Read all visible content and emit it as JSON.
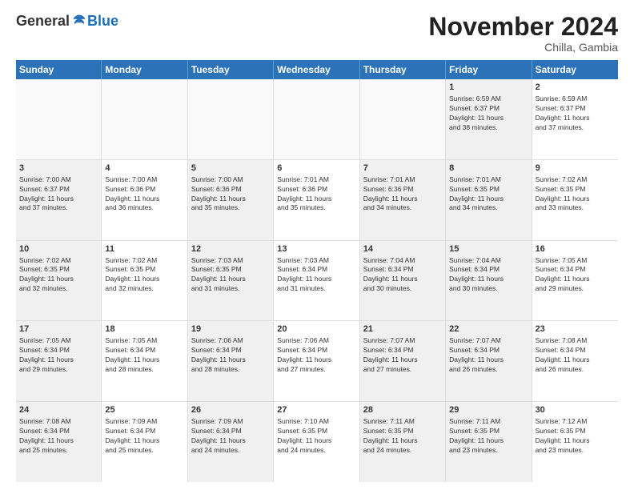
{
  "logo": {
    "general": "General",
    "blue": "Blue"
  },
  "title": "November 2024",
  "location": "Chilla, Gambia",
  "days": [
    "Sunday",
    "Monday",
    "Tuesday",
    "Wednesday",
    "Thursday",
    "Friday",
    "Saturday"
  ],
  "rows": [
    [
      {
        "day": "",
        "empty": true
      },
      {
        "day": "",
        "empty": true
      },
      {
        "day": "",
        "empty": true
      },
      {
        "day": "",
        "empty": true
      },
      {
        "day": "",
        "empty": true
      },
      {
        "day": "1",
        "lines": [
          "Sunrise: 6:59 AM",
          "Sunset: 6:37 PM",
          "Daylight: 11 hours",
          "and 38 minutes."
        ],
        "shaded": true
      },
      {
        "day": "2",
        "lines": [
          "Sunrise: 6:59 AM",
          "Sunset: 6:37 PM",
          "Daylight: 11 hours",
          "and 37 minutes."
        ],
        "shaded": false
      }
    ],
    [
      {
        "day": "3",
        "lines": [
          "Sunrise: 7:00 AM",
          "Sunset: 6:37 PM",
          "Daylight: 11 hours",
          "and 37 minutes."
        ],
        "shaded": true
      },
      {
        "day": "4",
        "lines": [
          "Sunrise: 7:00 AM",
          "Sunset: 6:36 PM",
          "Daylight: 11 hours",
          "and 36 minutes."
        ],
        "shaded": false
      },
      {
        "day": "5",
        "lines": [
          "Sunrise: 7:00 AM",
          "Sunset: 6:36 PM",
          "Daylight: 11 hours",
          "and 35 minutes."
        ],
        "shaded": true
      },
      {
        "day": "6",
        "lines": [
          "Sunrise: 7:01 AM",
          "Sunset: 6:36 PM",
          "Daylight: 11 hours",
          "and 35 minutes."
        ],
        "shaded": false
      },
      {
        "day": "7",
        "lines": [
          "Sunrise: 7:01 AM",
          "Sunset: 6:36 PM",
          "Daylight: 11 hours",
          "and 34 minutes."
        ],
        "shaded": true
      },
      {
        "day": "8",
        "lines": [
          "Sunrise: 7:01 AM",
          "Sunset: 6:35 PM",
          "Daylight: 11 hours",
          "and 34 minutes."
        ],
        "shaded": true
      },
      {
        "day": "9",
        "lines": [
          "Sunrise: 7:02 AM",
          "Sunset: 6:35 PM",
          "Daylight: 11 hours",
          "and 33 minutes."
        ],
        "shaded": false
      }
    ],
    [
      {
        "day": "10",
        "lines": [
          "Sunrise: 7:02 AM",
          "Sunset: 6:35 PM",
          "Daylight: 11 hours",
          "and 32 minutes."
        ],
        "shaded": true
      },
      {
        "day": "11",
        "lines": [
          "Sunrise: 7:02 AM",
          "Sunset: 6:35 PM",
          "Daylight: 11 hours",
          "and 32 minutes."
        ],
        "shaded": false
      },
      {
        "day": "12",
        "lines": [
          "Sunrise: 7:03 AM",
          "Sunset: 6:35 PM",
          "Daylight: 11 hours",
          "and 31 minutes."
        ],
        "shaded": true
      },
      {
        "day": "13",
        "lines": [
          "Sunrise: 7:03 AM",
          "Sunset: 6:34 PM",
          "Daylight: 11 hours",
          "and 31 minutes."
        ],
        "shaded": false
      },
      {
        "day": "14",
        "lines": [
          "Sunrise: 7:04 AM",
          "Sunset: 6:34 PM",
          "Daylight: 11 hours",
          "and 30 minutes."
        ],
        "shaded": true
      },
      {
        "day": "15",
        "lines": [
          "Sunrise: 7:04 AM",
          "Sunset: 6:34 PM",
          "Daylight: 11 hours",
          "and 30 minutes."
        ],
        "shaded": true
      },
      {
        "day": "16",
        "lines": [
          "Sunrise: 7:05 AM",
          "Sunset: 6:34 PM",
          "Daylight: 11 hours",
          "and 29 minutes."
        ],
        "shaded": false
      }
    ],
    [
      {
        "day": "17",
        "lines": [
          "Sunrise: 7:05 AM",
          "Sunset: 6:34 PM",
          "Daylight: 11 hours",
          "and 29 minutes."
        ],
        "shaded": true
      },
      {
        "day": "18",
        "lines": [
          "Sunrise: 7:05 AM",
          "Sunset: 6:34 PM",
          "Daylight: 11 hours",
          "and 28 minutes."
        ],
        "shaded": false
      },
      {
        "day": "19",
        "lines": [
          "Sunrise: 7:06 AM",
          "Sunset: 6:34 PM",
          "Daylight: 11 hours",
          "and 28 minutes."
        ],
        "shaded": true
      },
      {
        "day": "20",
        "lines": [
          "Sunrise: 7:06 AM",
          "Sunset: 6:34 PM",
          "Daylight: 11 hours",
          "and 27 minutes."
        ],
        "shaded": false
      },
      {
        "day": "21",
        "lines": [
          "Sunrise: 7:07 AM",
          "Sunset: 6:34 PM",
          "Daylight: 11 hours",
          "and 27 minutes."
        ],
        "shaded": true
      },
      {
        "day": "22",
        "lines": [
          "Sunrise: 7:07 AM",
          "Sunset: 6:34 PM",
          "Daylight: 11 hours",
          "and 26 minutes."
        ],
        "shaded": true
      },
      {
        "day": "23",
        "lines": [
          "Sunrise: 7:08 AM",
          "Sunset: 6:34 PM",
          "Daylight: 11 hours",
          "and 26 minutes."
        ],
        "shaded": false
      }
    ],
    [
      {
        "day": "24",
        "lines": [
          "Sunrise: 7:08 AM",
          "Sunset: 6:34 PM",
          "Daylight: 11 hours",
          "and 25 minutes."
        ],
        "shaded": true
      },
      {
        "day": "25",
        "lines": [
          "Sunrise: 7:09 AM",
          "Sunset: 6:34 PM",
          "Daylight: 11 hours",
          "and 25 minutes."
        ],
        "shaded": false
      },
      {
        "day": "26",
        "lines": [
          "Sunrise: 7:09 AM",
          "Sunset: 6:34 PM",
          "Daylight: 11 hours",
          "and 24 minutes."
        ],
        "shaded": true
      },
      {
        "day": "27",
        "lines": [
          "Sunrise: 7:10 AM",
          "Sunset: 6:35 PM",
          "Daylight: 11 hours",
          "and 24 minutes."
        ],
        "shaded": false
      },
      {
        "day": "28",
        "lines": [
          "Sunrise: 7:11 AM",
          "Sunset: 6:35 PM",
          "Daylight: 11 hours",
          "and 24 minutes."
        ],
        "shaded": true
      },
      {
        "day": "29",
        "lines": [
          "Sunrise: 7:11 AM",
          "Sunset: 6:35 PM",
          "Daylight: 11 hours",
          "and 23 minutes."
        ],
        "shaded": true
      },
      {
        "day": "30",
        "lines": [
          "Sunrise: 7:12 AM",
          "Sunset: 6:35 PM",
          "Daylight: 11 hours",
          "and 23 minutes."
        ],
        "shaded": false
      }
    ]
  ]
}
